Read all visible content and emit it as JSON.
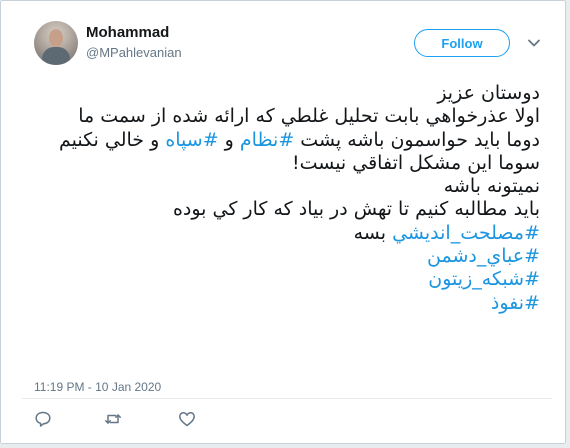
{
  "author": {
    "display_name": "Mohammad",
    "handle": "@MPahlevanian"
  },
  "follow_button": {
    "label": "Follow"
  },
  "tweet": {
    "line1": "دوستان عزیز",
    "line2": "اولا عذرخواهي بابت تحليل غلطي که ارائه شده از سمت ما",
    "line3": {
      "a": "دوما بايد حواسمون باشه پشت ",
      "hashtag1": "#نظام",
      "b": " و ",
      "hashtag2": "#سپاه",
      "c": " و خالي نکنيم"
    },
    "line4": "سوما اين مشکل اتفاقي نيست!",
    "line5": "نميتونه باشه",
    "line6": "بايد مطالبه کنيم تا تهش در بياد که کار کي بوده",
    "line7": {
      "hashtag": "#مصلحت_انديشي",
      "text": " بسه"
    },
    "hashtag_lines": [
      "#عباي_دشمن",
      "#شبکه_زيتون",
      "#نفوذ"
    ]
  },
  "timestamp": "11:19 PM - 10 Jan 2020",
  "icons": {
    "reply": "comment-icon",
    "retweet": "retweet-icon",
    "like": "heart-icon",
    "more": "chevron-down-icon",
    "colors": {
      "accent": "#1da1f2",
      "hashtag": "#1b95e0",
      "muted": "#657786",
      "text": "#14171a"
    }
  }
}
